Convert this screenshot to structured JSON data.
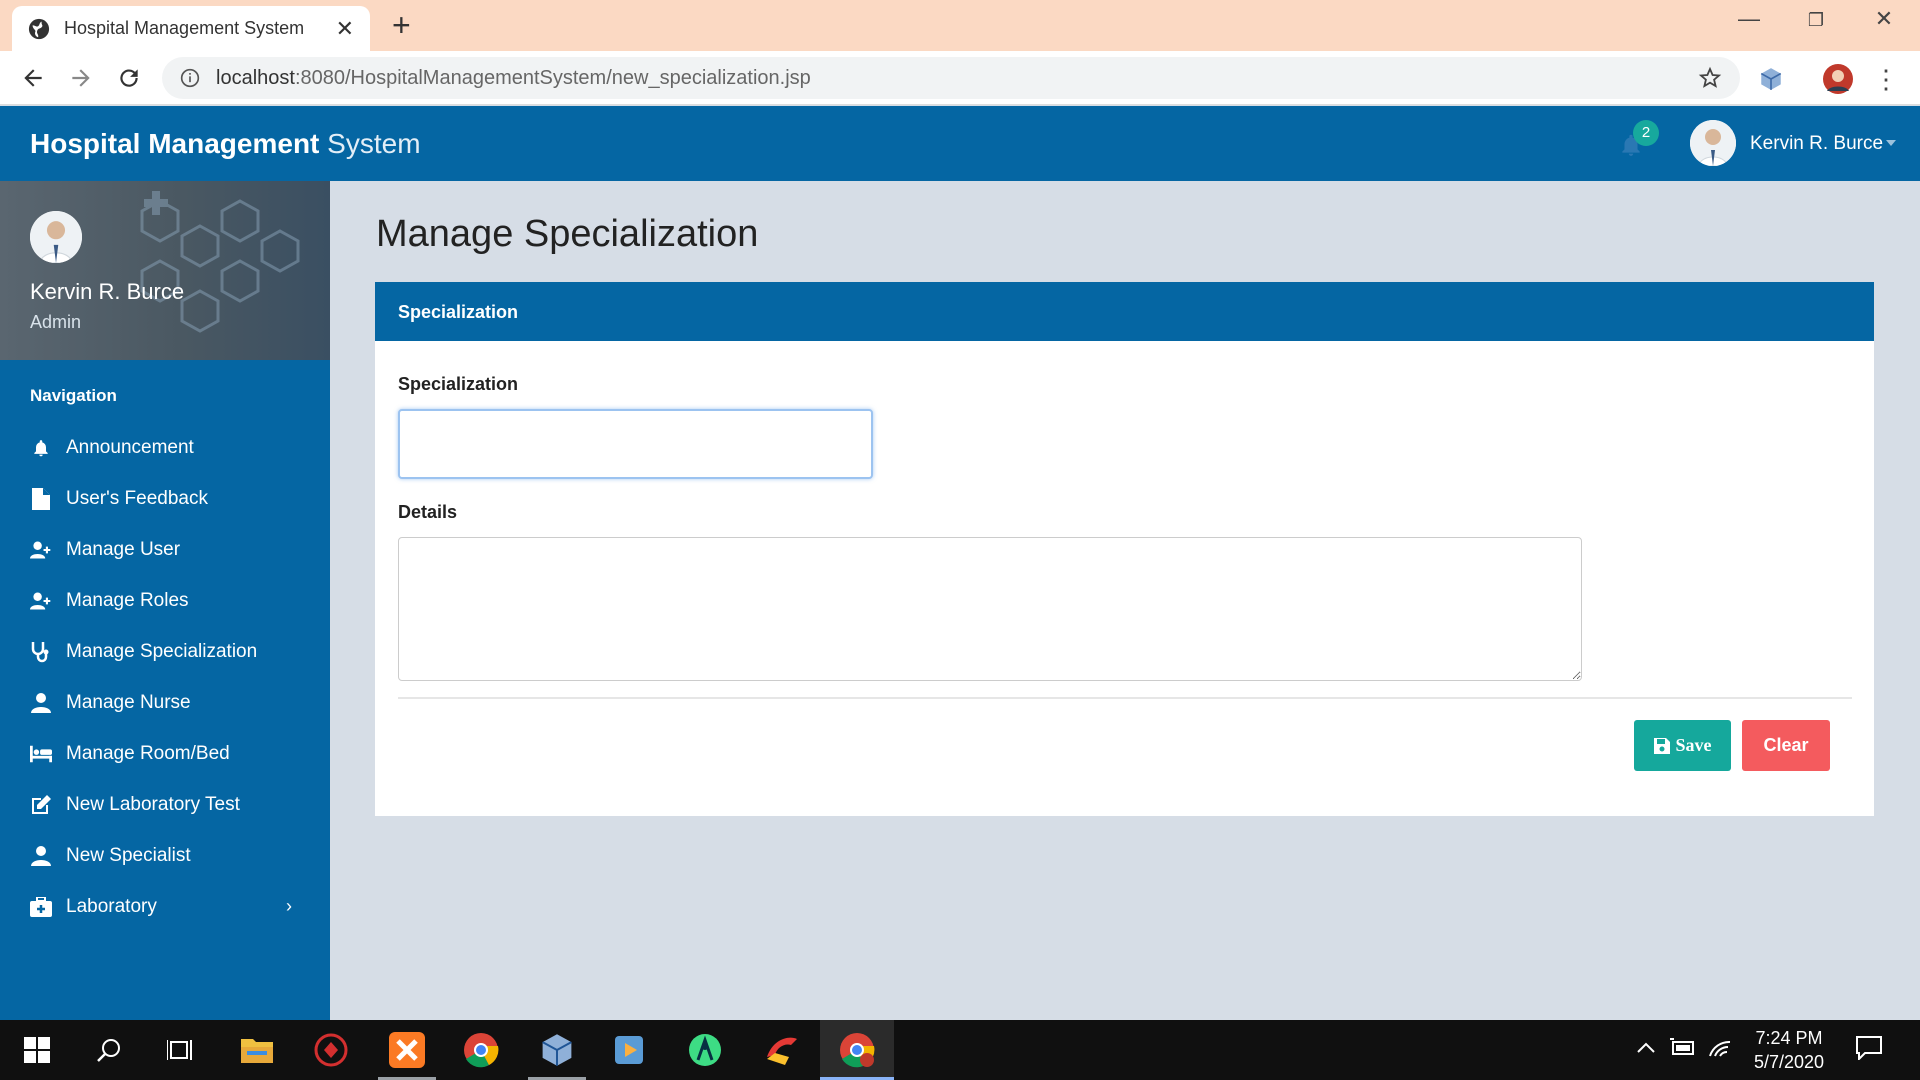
{
  "browser": {
    "tab_title": "Hospital Management System",
    "url_host": "localhost",
    "url_path": ":8080/HospitalManagementSystem/new_specialization.jsp"
  },
  "header": {
    "brand_bold": "Hospital Management",
    "brand_light": "System",
    "notification_count": "2",
    "user_name": "Kervin R. Burce"
  },
  "sidebar": {
    "profile_name": "Kervin R. Burce",
    "profile_role": "Admin",
    "nav_title": "Navigation",
    "items": [
      {
        "label": "Announcement",
        "icon": "bell-icon"
      },
      {
        "label": "User's Feedback",
        "icon": "document-icon"
      },
      {
        "label": "Manage User",
        "icon": "user-plus-icon"
      },
      {
        "label": "Manage Roles",
        "icon": "user-plus-icon"
      },
      {
        "label": "Manage Specialization",
        "icon": "stethoscope-icon"
      },
      {
        "label": "Manage Nurse",
        "icon": "user-icon"
      },
      {
        "label": "Manage Room/Bed",
        "icon": "bed-icon"
      },
      {
        "label": "New Laboratory Test",
        "icon": "edit-icon"
      },
      {
        "label": "New Specialist",
        "icon": "user-icon"
      },
      {
        "label": "Laboratory",
        "icon": "medkit-icon",
        "has_submenu": true
      }
    ]
  },
  "main": {
    "page_title": "Manage Specialization",
    "card_title": "Specialization",
    "specialization_label": "Specialization",
    "specialization_value": "",
    "details_label": "Details",
    "details_value": "",
    "save_label": "Save",
    "clear_label": "Clear"
  },
  "taskbar": {
    "time": "7:24 PM",
    "date": "5/7/2020"
  },
  "colors": {
    "primary": "#0566a3",
    "save": "#15a89c",
    "clear": "#f45b5e",
    "badge": "#17a99d",
    "tabstrip": "#fbd9c3"
  }
}
